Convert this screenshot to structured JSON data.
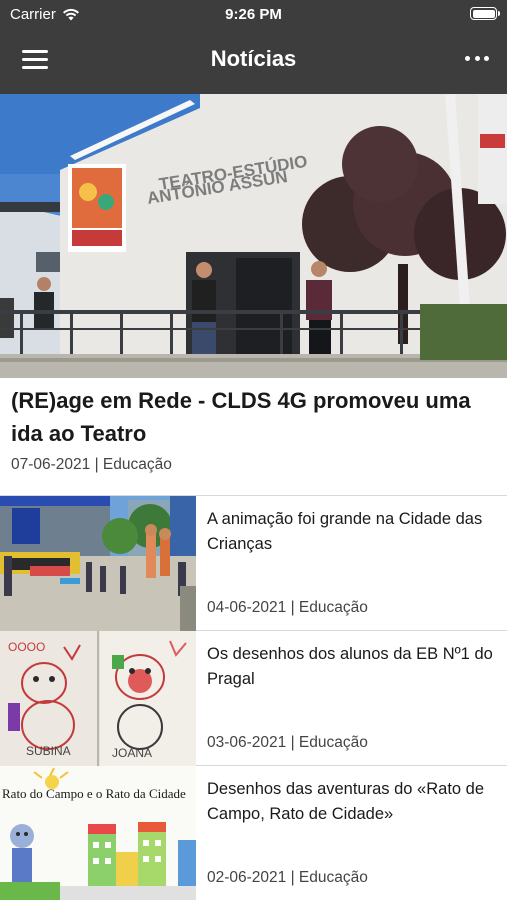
{
  "status_bar": {
    "carrier": "Carrier",
    "time": "9:26 PM"
  },
  "nav": {
    "title": "Notícias"
  },
  "featured": {
    "title": "(RE)age em Rede - CLDS 4G promoveu uma ida ao Teatro",
    "meta": "07-06-2021 | Educação",
    "image_text_line1": "TEATRO-ESTÚDIO",
    "image_text_line2": "ANTÓNIO ASSUN"
  },
  "news": [
    {
      "title": "A animação foi grande na Cidade das Crianças",
      "meta": "04-06-2021 | Educação"
    },
    {
      "title": "Os desenhos dos alunos da EB Nº1 do Pragal",
      "meta": "03-06-2021 | Educação",
      "drawing_names": [
        "SUBINA",
        "JOANA"
      ]
    },
    {
      "title": "Desenhos das aventuras do «Rato de Campo, Rato de Cidade»",
      "meta": "02-06-2021 | Educação",
      "drawing_caption": "Rato do Campo e o Rato da Cidade"
    }
  ],
  "colors": {
    "topbar": "#3d3d3d",
    "divider": "#d8d8d8",
    "text": "#1a1a1a",
    "meta": "#444444"
  }
}
